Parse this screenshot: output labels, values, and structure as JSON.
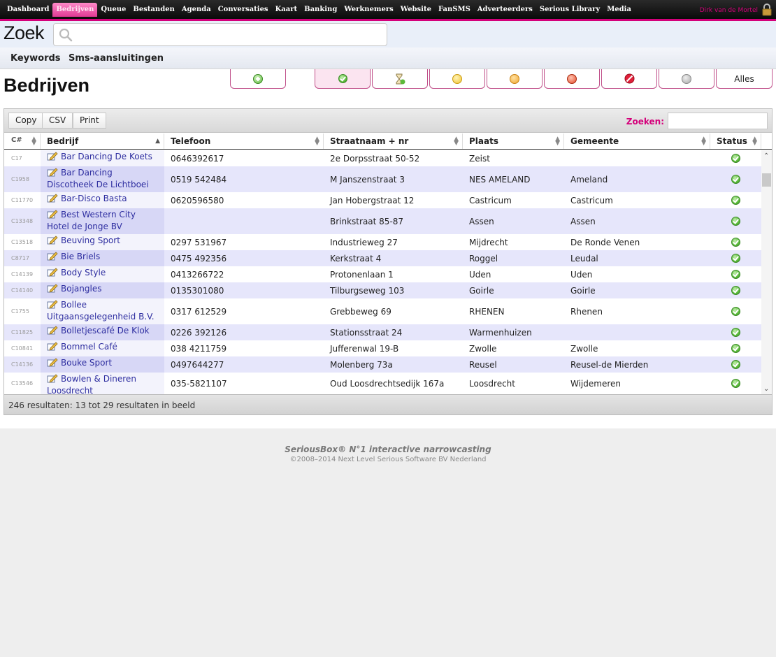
{
  "nav": {
    "items": [
      "Dashboard",
      "Bedrijven",
      "Queue",
      "Bestanden",
      "Agenda",
      "Conversaties",
      "Kaart",
      "Banking",
      "Werknemers",
      "Website",
      "FanSMS",
      "Adverteerders",
      "Serious Library",
      "Media"
    ],
    "active": "Bedrijven",
    "user": "Dirk van de Mortel"
  },
  "search": {
    "title": "Zoek",
    "value": ""
  },
  "subnav": {
    "keywords": "Keywords",
    "sms": "Sms-aansluitingen"
  },
  "page": {
    "title": "Bedrijven"
  },
  "filters": {
    "alles": "Alles"
  },
  "toolbar": {
    "copy": "Copy",
    "csv": "CSV",
    "print": "Print",
    "zoeken": "Zoeken:"
  },
  "table": {
    "headers": {
      "c": "C#",
      "bedrijf": "Bedrijf",
      "telefoon": "Telefoon",
      "straat": "Straatnaam + nr",
      "plaats": "Plaats",
      "gemeente": "Gemeente",
      "status": "Status"
    },
    "rows": [
      {
        "c": "C17",
        "bedrijf": "Bar Dancing De Koets",
        "tel": "0646392617",
        "straat": "2e Dorpsstraat 50-52",
        "plaats": "Zeist",
        "gemeente": ""
      },
      {
        "c": "C1958",
        "bedrijf": "Bar Dancing Discotheek De Lichtboei",
        "tel": "0519 542484",
        "straat": "M Janszenstraat 3",
        "plaats": "NES AMELAND",
        "gemeente": "Ameland"
      },
      {
        "c": "C11770",
        "bedrijf": "Bar-Disco Basta",
        "tel": "0620596580",
        "straat": "Jan Hobergstraat 12",
        "plaats": "Castricum",
        "gemeente": "Castricum"
      },
      {
        "c": "C13348",
        "bedrijf": "Best Western City Hotel de Jonge BV",
        "tel": "",
        "straat": "Brinkstraat 85-87",
        "plaats": "Assen",
        "gemeente": "Assen"
      },
      {
        "c": "C13518",
        "bedrijf": "Beuving Sport",
        "tel": "0297 531967",
        "straat": "Industrieweg 27",
        "plaats": "Mijdrecht",
        "gemeente": "De Ronde Venen"
      },
      {
        "c": "C8717",
        "bedrijf": "Bie Briels",
        "tel": "0475 492356",
        "straat": "Kerkstraat 4",
        "plaats": "Roggel",
        "gemeente": "Leudal"
      },
      {
        "c": "C14139",
        "bedrijf": "Body Style",
        "tel": "0413266722",
        "straat": "Protonenlaan 1",
        "plaats": "Uden",
        "gemeente": "Uden"
      },
      {
        "c": "C14140",
        "bedrijf": "Bojangles",
        "tel": "0135301080",
        "straat": "Tilburgseweg 103",
        "plaats": "Goirle",
        "gemeente": "Goirle"
      },
      {
        "c": "C1755",
        "bedrijf": "Bollee Uitgaansgelegenheid B.V.",
        "tel": "0317 612529",
        "straat": "Grebbeweg 69",
        "plaats": "RHENEN",
        "gemeente": "Rhenen"
      },
      {
        "c": "C11825",
        "bedrijf": "Bolletjescafé De Klok",
        "tel": "0226 392126",
        "straat": "Stationsstraat 24",
        "plaats": "Warmenhuizen",
        "gemeente": ""
      },
      {
        "c": "C10841",
        "bedrijf": "Bommel Café",
        "tel": "038 4211759",
        "straat": "Jufferenwal 19-B",
        "plaats": "Zwolle",
        "gemeente": "Zwolle"
      },
      {
        "c": "C14136",
        "bedrijf": "Bouke Sport",
        "tel": "0497644277",
        "straat": "Molenberg 73a",
        "plaats": "Reusel",
        "gemeente": "Reusel-de Mierden"
      },
      {
        "c": "C13546",
        "bedrijf": "Bowlen & Dineren Loosdrecht",
        "tel": "035-5821107",
        "straat": "Oud Loosdrechtsedijk 167a",
        "plaats": "Loosdrecht",
        "gemeente": "Wijdemeren"
      }
    ]
  },
  "footer": {
    "results": "246 resultaten: 13 tot 29 resultaten in beeld"
  },
  "site": {
    "brand": "SeriousBox® N°1 interactive narrowcasting",
    "copy": "©2008–2014 Next Level Serious Software BV Nederland"
  },
  "colors": {
    "accent": "#d4007a",
    "link": "#2e2ea0",
    "rowAlt": "#e6e6fb"
  }
}
